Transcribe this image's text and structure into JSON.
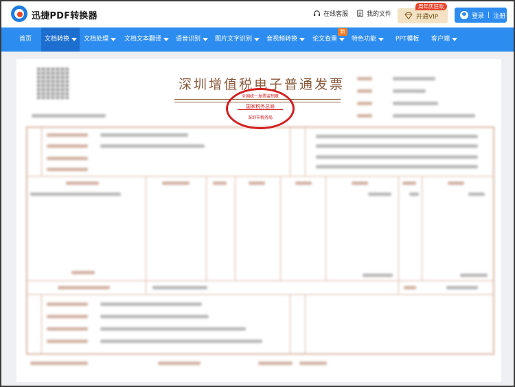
{
  "header": {
    "brand": "迅捷PDF转换器",
    "online_service": "在线客服",
    "my_files": "我的文件",
    "vip_badge": "周年庆狂欢",
    "vip_label": "开通VIP",
    "login_label": "登录",
    "register_label": "注册",
    "login_sep": "|"
  },
  "nav": {
    "items": [
      {
        "label": "首页",
        "has_caret": false
      },
      {
        "label": "文档转换",
        "has_caret": true
      },
      {
        "label": "文档处理",
        "has_caret": true
      },
      {
        "label": "文档文本翻译",
        "has_caret": true
      },
      {
        "label": "语音识别",
        "has_caret": true
      },
      {
        "label": "图片文字识别",
        "has_caret": true
      },
      {
        "label": "音视频转换",
        "has_caret": true
      },
      {
        "label": "论文查重",
        "has_caret": true
      },
      {
        "label": "特色功能",
        "has_caret": true
      },
      {
        "label": "PPT模板",
        "has_caret": false
      },
      {
        "label": "客户端",
        "has_caret": true
      }
    ],
    "new_badge": "新"
  },
  "invoice": {
    "title": "深圳增值税电子普通发票",
    "stamp_top": "全国统一发票监制章",
    "stamp_middle": "国家税务总局",
    "stamp_bottom": "深圳市税务局"
  },
  "colors": {
    "accent": "#2d8cf0",
    "nav_active": "#1c6fcf",
    "stamp": "#d21f1f",
    "invoice_brown": "#8a5a3c"
  }
}
